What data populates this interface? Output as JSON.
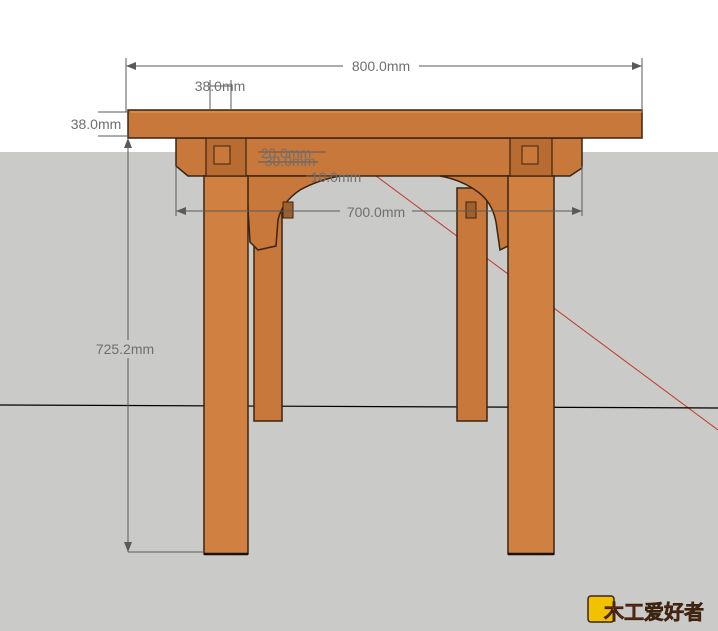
{
  "colors": {
    "sky": "#ffffff",
    "ground": "#cacac8",
    "wood": "#c8783a",
    "wood_dark": "#8c4a1c",
    "wood_light": "#d98c4a",
    "edge": "#3a2410",
    "dimension_line": "#5a5a5a",
    "axis_red": "#c0392b",
    "axis_black": "#000000",
    "logo_red": "#d42a1a",
    "logo_yellow": "#f2c200"
  },
  "dimensions": {
    "overall_width": "800.0mm",
    "top_thickness_small": "38.0mm",
    "top_thickness": "38.0mm",
    "leg_span": "700.0mm",
    "height": "725.2mm",
    "apron_a": "20.0mm",
    "apron_b": "30.0mm",
    "apron_c": "10.0mm"
  },
  "icons": {
    "logo": "wooden-craft-logo-icon"
  },
  "logo": {
    "text": "木工爱好者"
  }
}
